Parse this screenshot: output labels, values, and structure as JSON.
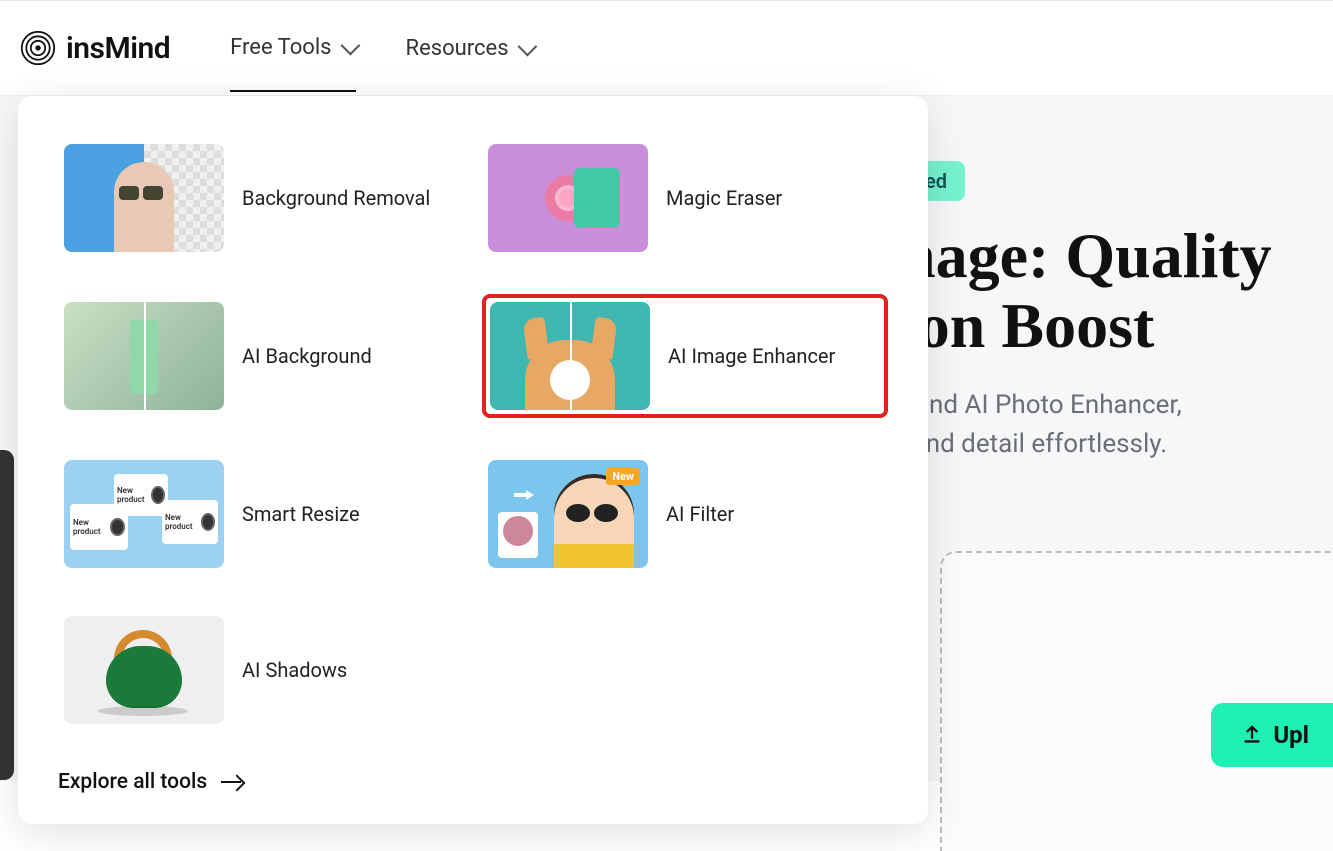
{
  "brand": {
    "name": "insMind"
  },
  "nav": {
    "free_tools": "Free Tools",
    "resources": "Resources"
  },
  "hero": {
    "badge": "red",
    "title_line1": "nage: Quality",
    "title_line2": "ion Boost",
    "desc_line1": "Mind AI Photo Enhancer,",
    "desc_line2": ", and detail effortlessly.",
    "upload": "Upl"
  },
  "tools": {
    "bg_removal": "Background Removal",
    "magic_eraser": "Magic Eraser",
    "ai_background": "AI Background",
    "ai_enhancer": "AI Image Enhancer",
    "smart_resize": "Smart Resize",
    "ai_filter": "AI Filter",
    "ai_shadows": "AI Shadows",
    "filter_badge": "New",
    "resize_text": "New product"
  },
  "explore": "Explore all tools"
}
